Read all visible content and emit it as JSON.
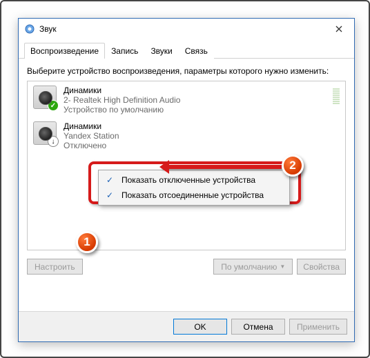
{
  "window": {
    "title": "Звук",
    "close": "×"
  },
  "tabs": [
    {
      "label": "Воспроизведение",
      "active": true
    },
    {
      "label": "Запись",
      "active": false
    },
    {
      "label": "Звуки",
      "active": false
    },
    {
      "label": "Связь",
      "active": false
    }
  ],
  "hint": "Выберите устройство воспроизведения, параметры которого нужно изменить:",
  "devices": [
    {
      "name": "Динамики",
      "sub": "2- Realtek High Definition Audio",
      "status": "Устройство по умолчанию",
      "badge": "ok"
    },
    {
      "name": "Динамики",
      "sub": "Yandex Station",
      "status": "Отключено",
      "badge": "disabled"
    }
  ],
  "menu": {
    "items": [
      "Показать отключенные устройства",
      "Показать отсоединенные устройства"
    ]
  },
  "buttons": {
    "configure": "Настроить",
    "setdefault": "По умолчанию",
    "properties": "Свойства",
    "ok": "OK",
    "cancel": "Отмена",
    "apply": "Применить"
  },
  "markers": {
    "m1": "1",
    "m2": "2"
  }
}
